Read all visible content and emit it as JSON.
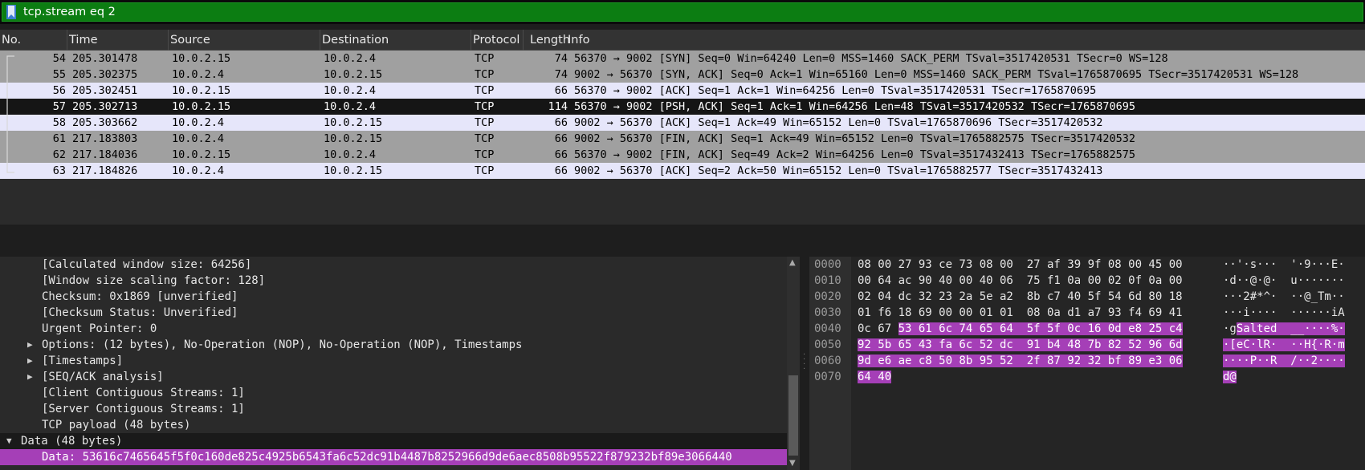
{
  "filter": {
    "value": "tcp.stream eq 2"
  },
  "packet_list": {
    "columns": [
      "No.",
      "Time",
      "Source",
      "Destination",
      "Protocol",
      "Length",
      "Info"
    ],
    "rows": [
      {
        "no": "54",
        "time": "205.301478",
        "src": "10.0.2.15",
        "dst": "10.0.2.4",
        "proto": "TCP",
        "len": "74",
        "info": "56370 → 9002 [SYN] Seq=0 Win=64240 Len=0 MSS=1460 SACK_PERM TSval=3517420531 TSecr=0 WS=128",
        "style": "grey"
      },
      {
        "no": "55",
        "time": "205.302375",
        "src": "10.0.2.4",
        "dst": "10.0.2.15",
        "proto": "TCP",
        "len": "74",
        "info": "9002 → 56370 [SYN, ACK] Seq=0 Ack=1 Win=65160 Len=0 MSS=1460 SACK_PERM TSval=1765870695 TSecr=3517420531 WS=128",
        "style": "grey"
      },
      {
        "no": "56",
        "time": "205.302451",
        "src": "10.0.2.15",
        "dst": "10.0.2.4",
        "proto": "TCP",
        "len": "66",
        "info": "56370 → 9002 [ACK] Seq=1 Ack=1 Win=64256 Len=0 TSval=3517420531 TSecr=1765870695",
        "style": "lav"
      },
      {
        "no": "57",
        "time": "205.302713",
        "src": "10.0.2.15",
        "dst": "10.0.2.4",
        "proto": "TCP",
        "len": "114",
        "info": "56370 → 9002 [PSH, ACK] Seq=1 Ack=1 Win=64256 Len=48 TSval=3517420532 TSecr=1765870695",
        "style": "sel"
      },
      {
        "no": "58",
        "time": "205.303662",
        "src": "10.0.2.4",
        "dst": "10.0.2.15",
        "proto": "TCP",
        "len": "66",
        "info": "9002 → 56370 [ACK] Seq=1 Ack=49 Win=65152 Len=0 TSval=1765870696 TSecr=3517420532",
        "style": "lav"
      },
      {
        "no": "61",
        "time": "217.183803",
        "src": "10.0.2.4",
        "dst": "10.0.2.15",
        "proto": "TCP",
        "len": "66",
        "info": "9002 → 56370 [FIN, ACK] Seq=1 Ack=49 Win=65152 Len=0 TSval=1765882575 TSecr=3517420532",
        "style": "grey"
      },
      {
        "no": "62",
        "time": "217.184036",
        "src": "10.0.2.15",
        "dst": "10.0.2.4",
        "proto": "TCP",
        "len": "66",
        "info": "56370 → 9002 [FIN, ACK] Seq=49 Ack=2 Win=64256 Len=0 TSval=3517432413 TSecr=1765882575",
        "style": "grey"
      },
      {
        "no": "63",
        "time": "217.184826",
        "src": "10.0.2.4",
        "dst": "10.0.2.15",
        "proto": "TCP",
        "len": "66",
        "info": "9002 → 56370 [ACK] Seq=2 Ack=50 Win=65152 Len=0 TSval=1765882577 TSecr=3517432413",
        "style": "lav"
      }
    ]
  },
  "details": [
    {
      "text": "[Calculated window size: 64256]",
      "indent": 2,
      "twisty": "",
      "style": ""
    },
    {
      "text": "[Window size scaling factor: 128]",
      "indent": 2,
      "twisty": "",
      "style": ""
    },
    {
      "text": "Checksum: 0x1869 [unverified]",
      "indent": 2,
      "twisty": "",
      "style": ""
    },
    {
      "text": "[Checksum Status: Unverified]",
      "indent": 2,
      "twisty": "",
      "style": ""
    },
    {
      "text": "Urgent Pointer: 0",
      "indent": 2,
      "twisty": "",
      "style": ""
    },
    {
      "text": "Options: (12 bytes), No-Operation (NOP), No-Operation (NOP), Timestamps",
      "indent": 2,
      "twisty": "›",
      "style": ""
    },
    {
      "text": "[Timestamps]",
      "indent": 2,
      "twisty": "›",
      "style": ""
    },
    {
      "text": "[SEQ/ACK analysis]",
      "indent": 2,
      "twisty": "›",
      "style": ""
    },
    {
      "text": "[Client Contiguous Streams: 1]",
      "indent": 2,
      "twisty": "",
      "style": ""
    },
    {
      "text": "[Server Contiguous Streams: 1]",
      "indent": 2,
      "twisty": "",
      "style": ""
    },
    {
      "text": "TCP payload (48 bytes)",
      "indent": 2,
      "twisty": "",
      "style": ""
    },
    {
      "text": "Data (48 bytes)",
      "indent": 1,
      "twisty": "⌄",
      "style": "dark"
    },
    {
      "text": "Data: 53616c7465645f5f0c160de825c4925b6543fa6c52dc91b4487b8252966d9de6aec8508b95522f879232bf89e3066440",
      "indent": 2,
      "twisty": "",
      "style": "hl"
    }
  ],
  "bytes": [
    {
      "offset": "0000",
      "hex_plain": "08 00 27 93 ce 73 08 00  27 af 39 9f 08 00 45 00",
      "hex_hl": "",
      "ascii_plain": "··'·s···  '·9···E·",
      "ascii_hl": ""
    },
    {
      "offset": "0010",
      "hex_plain": "00 64 ac 90 40 00 40 06  75 f1 0a 00 02 0f 0a 00",
      "hex_hl": "",
      "ascii_plain": "·d··@·@·  u·······",
      "ascii_hl": ""
    },
    {
      "offset": "0020",
      "hex_plain": "02 04 dc 32 23 2a 5e a2  8b c7 40 5f 54 6d 80 18",
      "hex_hl": "",
      "ascii_plain": "···2#*^·  ··@_Tm··",
      "ascii_hl": ""
    },
    {
      "offset": "0030",
      "hex_plain": "01 f6 18 69 00 00 01 01  08 0a d1 a7 93 f4 69 41",
      "hex_hl": "",
      "ascii_plain": "···i····  ······iA",
      "ascii_hl": ""
    },
    {
      "offset": "0040",
      "hex_plain": "0c 67 ",
      "hex_hl": "53 61 6c 74 65 64  5f 5f 0c 16 0d e8 25 c4",
      "ascii_plain": "·g",
      "ascii_hl": "Salted  __····%·"
    },
    {
      "offset": "0050",
      "hex_plain": "",
      "hex_hl": "92 5b 65 43 fa 6c 52 dc  91 b4 48 7b 82 52 96 6d",
      "ascii_plain": "",
      "ascii_hl": "·[eC·lR·  ··H{·R·m"
    },
    {
      "offset": "0060",
      "hex_plain": "",
      "hex_hl": "9d e6 ae c8 50 8b 95 52  2f 87 92 32 bf 89 e3 06",
      "ascii_plain": "",
      "ascii_hl": "····P··R  /··2····"
    },
    {
      "offset": "0070",
      "hex_plain": "",
      "hex_hl": "64 40",
      "ascii_plain": "",
      "ascii_hl": "d@"
    }
  ],
  "colors": {
    "filter_ok": "#0c7d12",
    "selected_row": "#151515",
    "highlight": "#a53fb7",
    "row_grey": "#a0a0a0",
    "row_lavender": "#e6e6fa"
  },
  "icons": {
    "filter_bookmark": "bookmark-icon"
  }
}
